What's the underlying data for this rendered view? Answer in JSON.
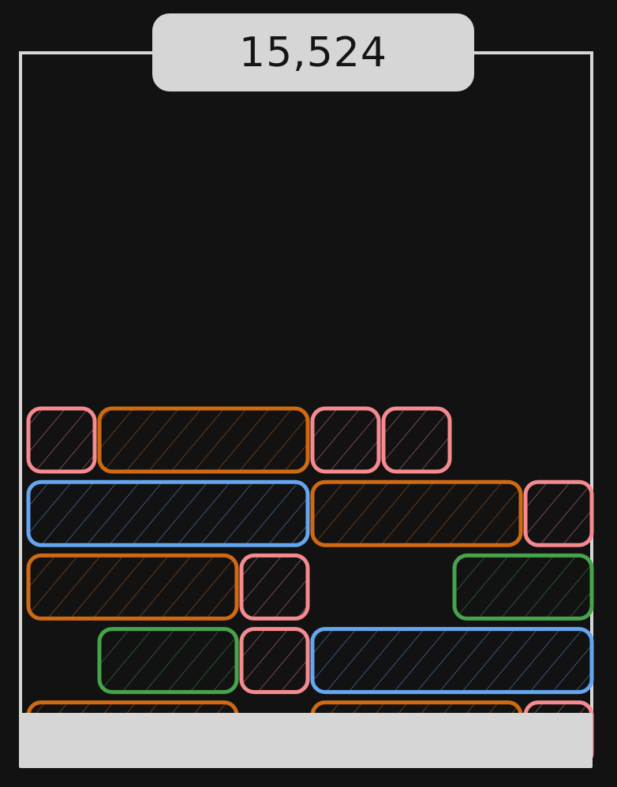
{
  "score": {
    "value": "15,524"
  },
  "colors": {
    "background": "#121213",
    "frame": "#d6d6d6",
    "pink": "#f58a8f",
    "orange": "#d06a12",
    "blue": "#64a6ef",
    "green": "#46a44a"
  },
  "board": {
    "columns": 8,
    "rows": [
      {
        "row": 0,
        "blocks": [
          {
            "col": 0,
            "width": 1,
            "color": "pink"
          },
          {
            "col": 1,
            "width": 3,
            "color": "orange"
          },
          {
            "col": 4,
            "width": 1,
            "color": "pink"
          },
          {
            "col": 5,
            "width": 1,
            "color": "pink"
          }
        ]
      },
      {
        "row": 1,
        "blocks": [
          {
            "col": 0,
            "width": 4,
            "color": "blue"
          },
          {
            "col": 4,
            "width": 3,
            "color": "orange"
          },
          {
            "col": 7,
            "width": 1,
            "color": "pink"
          }
        ]
      },
      {
        "row": 2,
        "blocks": [
          {
            "col": 0,
            "width": 3,
            "color": "orange"
          },
          {
            "col": 3,
            "width": 1,
            "color": "pink"
          },
          {
            "col": 6,
            "width": 2,
            "color": "green"
          }
        ]
      },
      {
        "row": 3,
        "blocks": [
          {
            "col": 1,
            "width": 2,
            "color": "green"
          },
          {
            "col": 3,
            "width": 1,
            "color": "pink"
          },
          {
            "col": 4,
            "width": 4,
            "color": "blue"
          }
        ]
      },
      {
        "row": 4,
        "blocks": [
          {
            "col": 0,
            "width": 3,
            "color": "orange"
          },
          {
            "col": 4,
            "width": 3,
            "color": "orange"
          },
          {
            "col": 7,
            "width": 1,
            "color": "pink"
          }
        ]
      }
    ]
  }
}
